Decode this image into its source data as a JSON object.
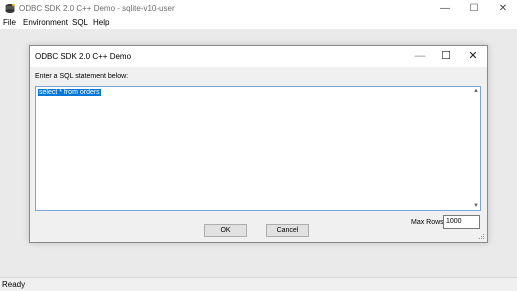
{
  "window": {
    "title": "ODBC SDK 2.0 C++ Demo - sqlite-v10-user",
    "minimize_glyph": "—",
    "maximize_glyph": "☐",
    "close_glyph": "✕"
  },
  "menu": [
    "File",
    "Environment",
    "SQL",
    "Help"
  ],
  "dialog": {
    "title": "ODBC SDK 2.0 C++ Demo",
    "minimize_glyph": "—",
    "maximize_glyph": "☐",
    "close_glyph": "✕",
    "prompt": "Enter a SQL statement below:",
    "sql_text": "select * from orders",
    "max_rows_label": "Max Rows:",
    "max_rows_value": "1000",
    "ok_label": "OK",
    "cancel_label": "Cancel",
    "scroll_up_glyph": "▲",
    "scroll_down_glyph": "▼"
  },
  "status": {
    "text": "Ready"
  },
  "colors": {
    "selection": "#0078d7",
    "focus_border": "#7aa7d8",
    "client_bg": "#eaeaea",
    "dialog_bg": "#f0f0f0"
  }
}
